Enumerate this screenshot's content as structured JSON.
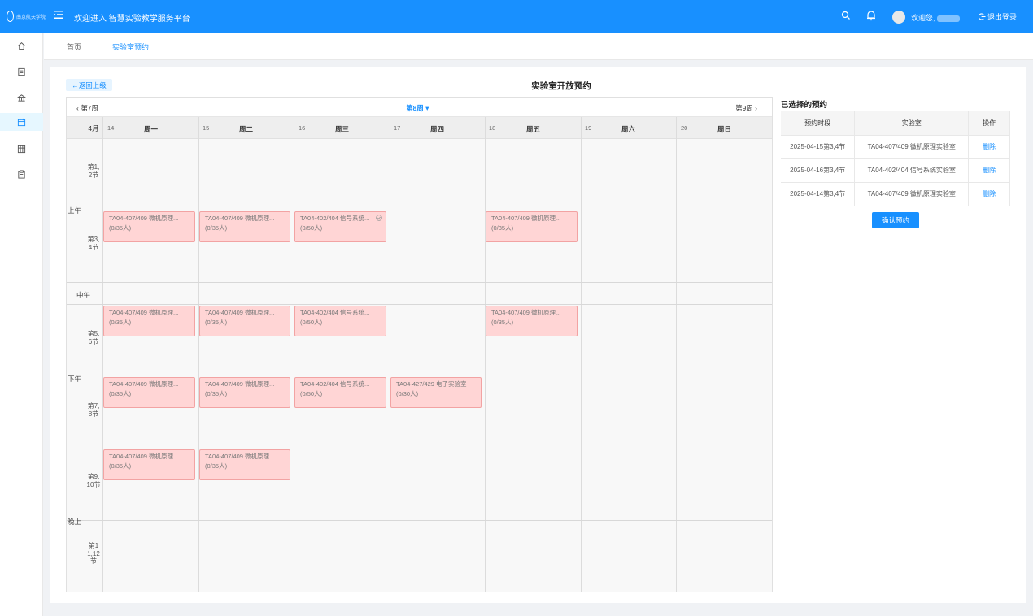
{
  "header": {
    "logo_text": "南京航天学院",
    "title": "欢迎进入 智慧实验教学服务平台",
    "welcome": "欢迎您,",
    "logout": "退出登录"
  },
  "sidebar": {
    "items": [
      {
        "icon": "home-icon",
        "active": false
      },
      {
        "icon": "document-icon",
        "active": false
      },
      {
        "icon": "bank-icon",
        "active": false
      },
      {
        "icon": "calendar-icon",
        "active": true
      },
      {
        "icon": "grid-icon",
        "active": false
      },
      {
        "icon": "clipboard-icon",
        "active": false
      }
    ]
  },
  "tabs": [
    {
      "label": "首页",
      "active": false
    },
    {
      "label": "实验室预约",
      "active": true
    }
  ],
  "page": {
    "back": "返回上级",
    "title": "实验室开放预约"
  },
  "calendar": {
    "prev_week": "第7周",
    "current_week": "第8周",
    "next_week": "第9周",
    "month": "4月",
    "days": [
      {
        "num": "14",
        "name": "周一"
      },
      {
        "num": "15",
        "name": "周二"
      },
      {
        "num": "16",
        "name": "周三"
      },
      {
        "num": "17",
        "name": "周四"
      },
      {
        "num": "18",
        "name": "周五"
      },
      {
        "num": "19",
        "name": "周六"
      },
      {
        "num": "20",
        "name": "周日"
      }
    ],
    "periods": {
      "morning": "上午",
      "noon": "中午",
      "afternoon": "下午",
      "evening": "晚上"
    },
    "slots": [
      "第1,2节",
      "第3,4节",
      "第5,6节",
      "第7,8节",
      "第9,10节",
      "第11,12节"
    ],
    "events": {
      "e1": {
        "title": "TA04-407/409 微机原理...",
        "cap": "(0/35人)"
      },
      "e2": {
        "title": "TA04-407/409 微机原理...",
        "cap": "(0/35人)"
      },
      "e3": {
        "title": "TA04-402/404 信号系统...",
        "cap": "(0/50人)"
      },
      "e4": {
        "title": "TA04-407/409 微机原理...",
        "cap": "(0/35人)"
      },
      "e5": {
        "title": "TA04-407/409 微机原理...",
        "cap": "(0/35人)"
      },
      "e6": {
        "title": "TA04-407/409 微机原理...",
        "cap": "(0/35人)"
      },
      "e7": {
        "title": "TA04-402/404 信号系统...",
        "cap": "(0/50人)"
      },
      "e8": {
        "title": "TA04-407/409 微机原理...",
        "cap": "(0/35人)"
      },
      "e9": {
        "title": "TA04-407/409 微机原理...",
        "cap": "(0/35人)"
      },
      "e10": {
        "title": "TA04-407/409 微机原理...",
        "cap": "(0/35人)"
      },
      "e11": {
        "title": "TA04-402/404 信号系统...",
        "cap": "(0/50人)"
      },
      "e12": {
        "title": "TA04-427/429 电子实验室",
        "cap": "(0/30人)"
      },
      "e13": {
        "title": "TA04-407/409 微机原理...",
        "cap": "(0/35人)"
      },
      "e14": {
        "title": "TA04-407/409 微机原理...",
        "cap": "(0/35人)"
      }
    }
  },
  "selected": {
    "title": "已选择的预约",
    "columns": [
      "预约时段",
      "实验室",
      "操作"
    ],
    "rows": [
      {
        "time": "2025-04-15第3,4节",
        "lab": "TA04-407/409 微机原理实验室",
        "op": "删除"
      },
      {
        "time": "2025-04-16第3,4节",
        "lab": "TA04-402/404 信号系统实验室",
        "op": "删除"
      },
      {
        "time": "2025-04-14第3,4节",
        "lab": "TA04-407/409 微机原理实验室",
        "op": "删除"
      }
    ],
    "confirm": "确认预约"
  },
  "colors": {
    "primary": "#1890ff",
    "event_bg": "#ffd5d5",
    "event_border": "#f2a3a3"
  }
}
